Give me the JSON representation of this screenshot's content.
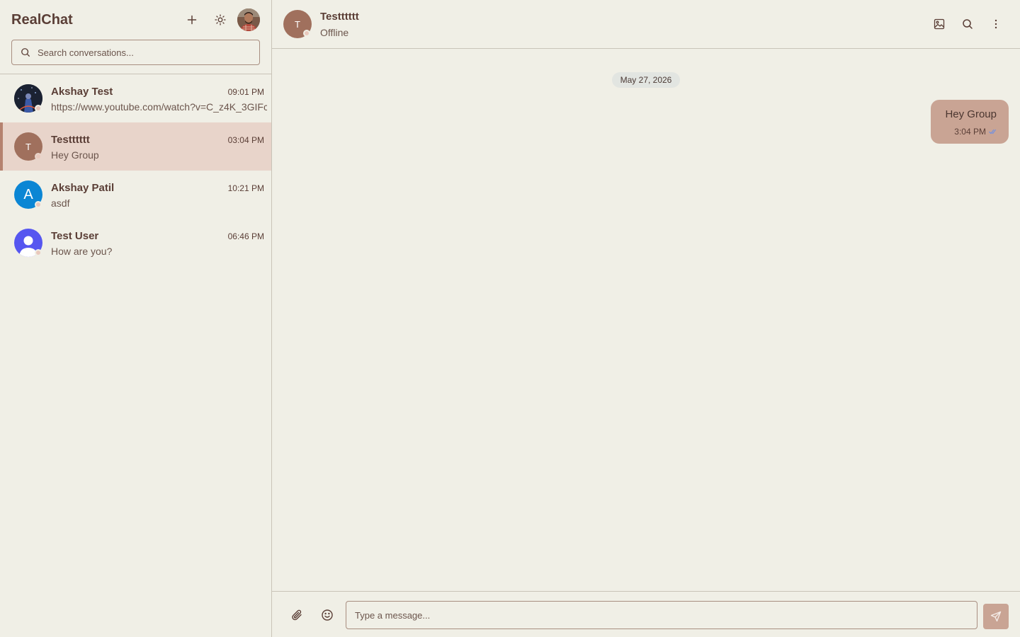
{
  "app": {
    "title": "RealChat"
  },
  "sidebar": {
    "search_placeholder": "Search conversations...",
    "conversations": [
      {
        "name": "Akshay Test",
        "time": "09:01 PM",
        "preview": "https://www.youtube.com/watch?v=C_z4K_3GIFc",
        "avatar": "photo-dark",
        "active": false
      },
      {
        "name": "Testttttt",
        "time": "03:04 PM",
        "preview": "Hey Group",
        "avatar_letter": "T",
        "active": true
      },
      {
        "name": "Akshay Patil",
        "time": "10:21 PM",
        "preview": "asdf",
        "avatar_letter": "A",
        "active": false
      },
      {
        "name": "Test User",
        "time": "06:46 PM",
        "preview": "How are you?",
        "avatar": "default-user",
        "active": false
      }
    ]
  },
  "chat": {
    "name": "Testttttt",
    "avatar_letter": "T",
    "status": "Offline",
    "date_separator": "May 27, 2026",
    "messages": [
      {
        "text": "Hey Group",
        "time": "3:04 PM",
        "read": true,
        "outgoing": true
      }
    ],
    "composer_placeholder": "Type a message..."
  },
  "colors": {
    "background": "#f0efe6",
    "accent": "#b5826f",
    "active_row": "#e8d4ca",
    "outgoing_bubble": "#c9a494",
    "avatar_brown": "#a0705d",
    "avatar_blue": "#0b86d4",
    "avatar_indigo": "#5656f0",
    "read_tick": "#6a8ee8"
  },
  "icons": [
    "plus-icon",
    "sun-icon",
    "search-icon",
    "image-icon",
    "more-vertical-icon",
    "paperclip-icon",
    "smile-icon",
    "send-icon",
    "double-check-icon"
  ]
}
